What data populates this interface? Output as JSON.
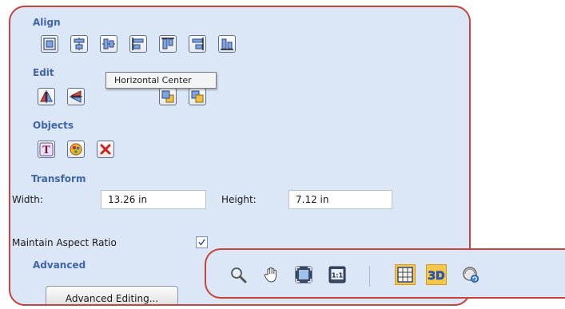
{
  "sections": {
    "align": "Align",
    "edit": "Edit",
    "objects": "Objects",
    "transform": "Transform",
    "advanced": "Advanced"
  },
  "tooltip": "Horizontal Center",
  "transform": {
    "width_label": "Width:",
    "width_value": "13.26 in",
    "height_label": "Height:",
    "height_value": "7.12 in",
    "aspect_label": "Maintain Aspect Ratio",
    "aspect_checked": true
  },
  "advanced_button": "Advanced Editing...",
  "view_toolbar": {
    "actual_size_label": "1:1",
    "three_d_label": "3D"
  },
  "colors": {
    "panel_bg": "#dbe6f6",
    "panel_border": "#c8433a",
    "section_label": "#3f64a8",
    "active_bg": "#f6c64a"
  },
  "icons": {
    "align": [
      "align-center-icon",
      "align-horizontal-center-icon",
      "align-vertical-center-icon",
      "align-left-icon",
      "align-top-icon",
      "align-right-icon",
      "align-bottom-icon"
    ],
    "edit": [
      "flip-horizontal-icon",
      "flip-vertical-icon",
      "bring-to-front-icon",
      "send-to-back-icon"
    ],
    "objects": [
      "text-tool-icon",
      "paint-tool-icon",
      "delete-icon"
    ],
    "view": [
      "zoom-icon",
      "pan-hand-icon",
      "fit-to-window-icon",
      "actual-size-icon",
      "grid-icon",
      "3d-view-icon",
      "rotate-view-icon"
    ]
  }
}
